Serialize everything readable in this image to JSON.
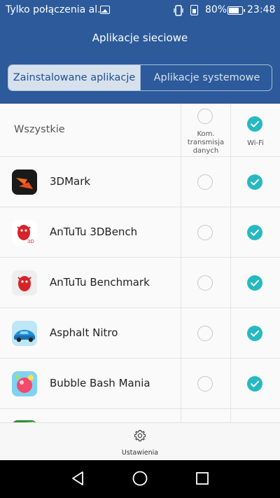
{
  "status_bar": {
    "notification_text": "Tylko połączenia al...",
    "icons": [
      "image-icon",
      "vibrate-icon",
      "sim-icon"
    ],
    "battery_text": "80%",
    "battery_level": 0.8,
    "time": "23:48"
  },
  "header": {
    "title": "Aplikacje sieciowe",
    "tabs": [
      {
        "label": "Zainstalowane aplikacje",
        "active": true
      },
      {
        "label": "Aplikacje systemowe",
        "active": false
      }
    ]
  },
  "list": {
    "all_label": "Wszystkie",
    "columns": [
      {
        "label": "Kom. transmisja danych",
        "all_checked": false
      },
      {
        "label": "Wi-Fi",
        "all_checked": true
      }
    ],
    "apps": [
      {
        "name": "3DMark",
        "icon": "3dmark-icon",
        "mobile_data": false,
        "wifi": true
      },
      {
        "name": "AnTuTu 3DBench",
        "icon": "antutu-3dbench-icon",
        "mobile_data": false,
        "wifi": true
      },
      {
        "name": "AnTuTu Benchmark",
        "icon": "antutu-benchmark-icon",
        "mobile_data": false,
        "wifi": true
      },
      {
        "name": "Asphalt Nitro",
        "icon": "asphalt-nitro-icon",
        "mobile_data": false,
        "wifi": true
      },
      {
        "name": "Bubble Bash Mania",
        "icon": "bubble-bash-mania-icon",
        "mobile_data": false,
        "wifi": true
      }
    ]
  },
  "bottom_bar": {
    "settings_label": "Ustawienia"
  },
  "colors": {
    "header_bg": "#2c5a9a",
    "accent_check": "#27b9c2",
    "unchecked": "#c7c7c7"
  }
}
